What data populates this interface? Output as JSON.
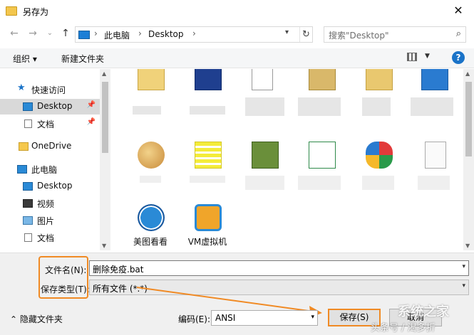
{
  "window": {
    "title": "另存为",
    "close_glyph": "✕"
  },
  "nav": {
    "back_glyph": "←",
    "forward_glyph": "→",
    "recent_glyph": "⌄",
    "up_glyph": "↑",
    "breadcrumb": [
      "此电脑",
      "Desktop"
    ],
    "crumb_sep": "›",
    "refresh_glyph": "↻",
    "search_placeholder": "搜索\"Desktop\"",
    "search_glyph": "⌕"
  },
  "toolbar": {
    "organize_label": "组织 ▾",
    "new_folder_label": "新建文件夹",
    "help_glyph": "?"
  },
  "sidebar": {
    "items": [
      {
        "label": "快速访问",
        "icon": "star-icon"
      },
      {
        "label": "Desktop",
        "icon": "desktop-icon",
        "pinned": true,
        "selected": true
      },
      {
        "label": "文档",
        "icon": "document-icon",
        "pinned": true
      },
      {
        "label": "OneDrive",
        "icon": "folder-icon"
      },
      {
        "label": "此电脑",
        "icon": "computer-icon"
      },
      {
        "label": "Desktop",
        "icon": "desktop-icon"
      },
      {
        "label": "视频",
        "icon": "video-icon"
      },
      {
        "label": "图片",
        "icon": "picture-icon"
      },
      {
        "label": "文档",
        "icon": "document-icon"
      }
    ],
    "pin_glyph": "📌"
  },
  "files": {
    "visible_names": [
      "美图看看",
      "VM虚拟机"
    ]
  },
  "form": {
    "filename_label": "文件名(N):",
    "filename_value": "删除免疫.bat",
    "filetype_label": "保存类型(T):",
    "filetype_value": "所有文件 (*.*)",
    "hide_folders_label": "隐藏文件夹",
    "encoding_label": "编码(E):",
    "encoding_value": "ANSI",
    "save_label": "保存(S)",
    "cancel_label": "取消"
  },
  "watermark": {
    "line1": "系统之家",
    "line2": "头条号 / 渴多折"
  },
  "colors": {
    "accent": "#1a73c8",
    "highlight": "#f08a24",
    "selection": "#d9d9d9"
  }
}
